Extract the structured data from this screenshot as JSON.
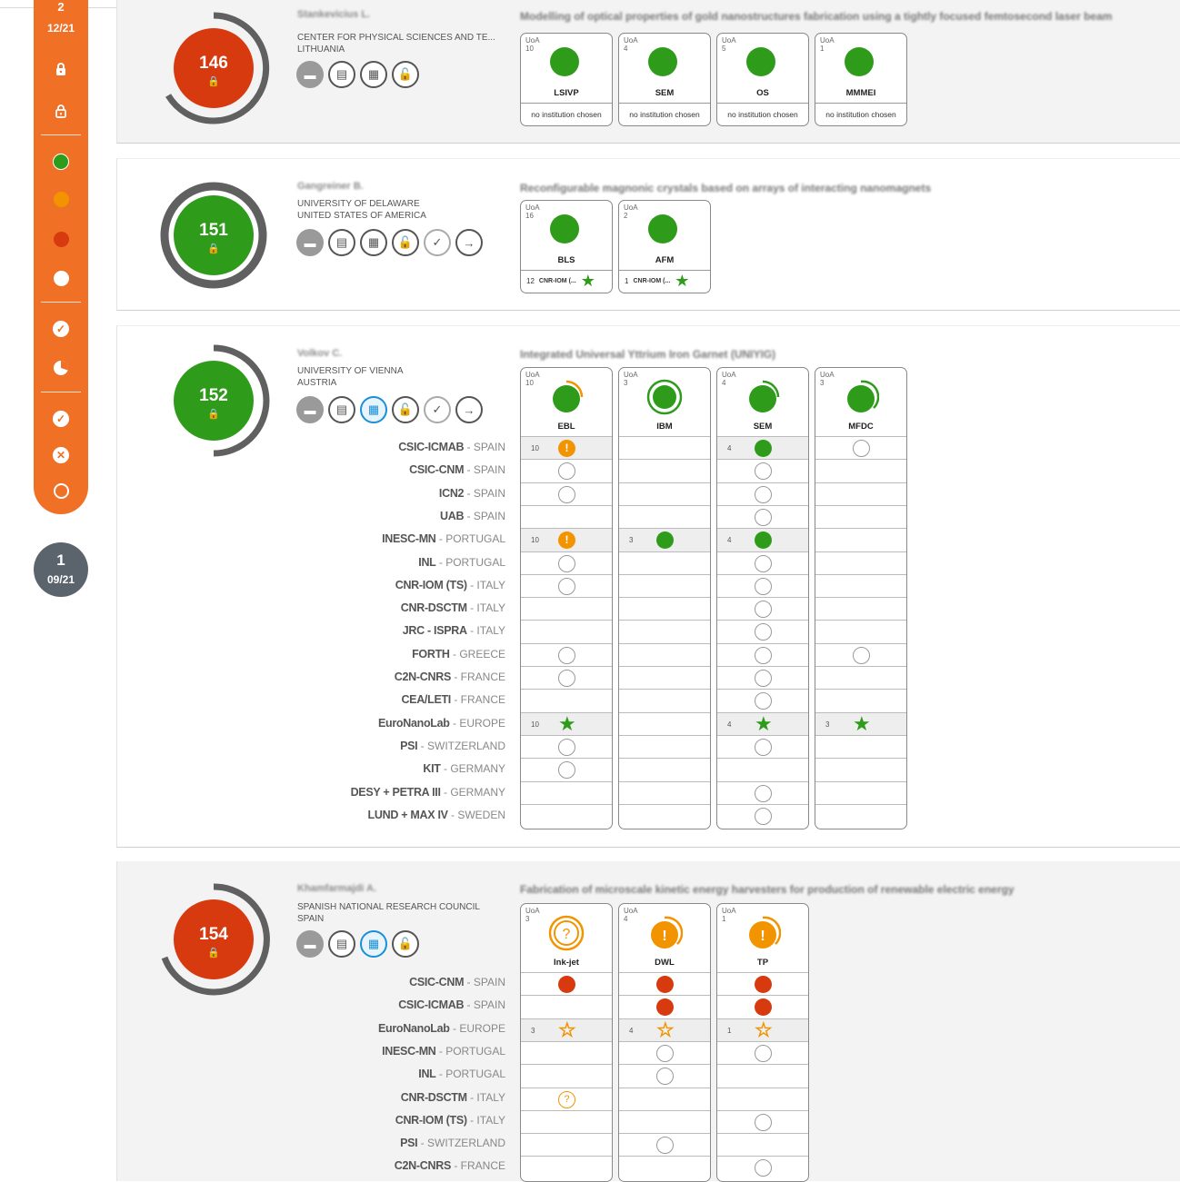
{
  "sidebar": {
    "top_number": "2",
    "top_date": "12/21",
    "filter_icons": [
      "lock-solid-icon",
      "lock-open-icon",
      "green-dot-icon",
      "orange-dot-icon",
      "red-dot-icon",
      "white-dot-icon",
      "check-circle-icon",
      "pie-icon",
      "check-circle-icon",
      "x-circle-icon",
      "ring-icon"
    ]
  },
  "month_badge": {
    "number": "1",
    "date": "09/21"
  },
  "colors": {
    "accent_orange": "#f07026",
    "green": "#2e9c1a",
    "red": "#d63a0e",
    "orange": "#f29400",
    "grey_badge": "#5b646d"
  },
  "proposals": [
    {
      "score": "146",
      "pi": "Stankevicius L.",
      "title": "Modelling of optical properties of gold nanostructures fabrication using a tightly focused femtosecond laser beam",
      "institution": "CENTER FOR PHYSICAL SCIENCES AND TE...",
      "country": "LITHUANIA",
      "techniques": [
        {
          "name": "LSIVP",
          "uoa": "10",
          "foot": "no institution chosen"
        },
        {
          "name": "SEM",
          "uoa": "4",
          "foot": "no institution chosen"
        },
        {
          "name": "OS",
          "uoa": "5",
          "foot": "no institution chosen"
        },
        {
          "name": "MMMEI",
          "uoa": "1",
          "foot": "no institution chosen"
        }
      ]
    },
    {
      "score": "151",
      "pi": "Gangreiner B.",
      "title": "Reconfigurable magnonic crystals based on arrays of interacting nanomagnets",
      "institution": "UNIVERSITY OF DELAWARE",
      "country": "UNITED STATES OF AMERICA",
      "techniques": [
        {
          "name": "BLS",
          "uoa": "16",
          "foot_count": "12",
          "foot_inst": "CNR-IOM (..."
        },
        {
          "name": "AFM",
          "uoa": "2",
          "foot_count": "1",
          "foot_inst": "CNR-IOM (..."
        }
      ]
    },
    {
      "score": "152",
      "pi": "Volkov C.",
      "title": "Integrated Universal Yttrium Iron Garnet (UNIYIG)",
      "institution": "UNIVERSITY OF VIENNA",
      "country": "AUSTRIA",
      "techniques": [
        {
          "name": "EBL",
          "uoa": "10"
        },
        {
          "name": "IBM",
          "uoa": "3"
        },
        {
          "name": "SEM",
          "uoa": "4"
        },
        {
          "name": "MFDC",
          "uoa": "3"
        }
      ],
      "rows": [
        {
          "inst": "CSIC-ICMAB",
          "country": "SPAIN"
        },
        {
          "inst": "CSIC-CNM",
          "country": "SPAIN"
        },
        {
          "inst": "ICN2",
          "country": "SPAIN"
        },
        {
          "inst": "UAB",
          "country": "SPAIN"
        },
        {
          "inst": "INESC-MN",
          "country": "PORTUGAL"
        },
        {
          "inst": "INL",
          "country": "PORTUGAL"
        },
        {
          "inst": "CNR-IOM (TS)",
          "country": "ITALY"
        },
        {
          "inst": "CNR-DSCTM",
          "country": "ITALY"
        },
        {
          "inst": "JRC - ISPRA",
          "country": "ITALY"
        },
        {
          "inst": "FORTH",
          "country": "GREECE"
        },
        {
          "inst": "C2N-CNRS",
          "country": "FRANCE"
        },
        {
          "inst": "CEA/LETI",
          "country": "FRANCE"
        },
        {
          "inst": "EuroNanoLab",
          "country": "EUROPE"
        },
        {
          "inst": "PSI",
          "country": "SWITZERLAND"
        },
        {
          "inst": "KIT",
          "country": "GERMANY"
        },
        {
          "inst": "DESY + PETRA III",
          "country": "GERMANY"
        },
        {
          "inst": "LUND + MAX IV",
          "country": "SWEDEN"
        }
      ],
      "cells": {
        "EBL": {
          "0": "orange-warn:10",
          "1": "empty",
          "2": "empty",
          "4": "orange-warn:10",
          "5": "empty",
          "6": "empty",
          "9": "empty",
          "10": "empty",
          "12": "star:10",
          "13": "empty",
          "14": "empty"
        },
        "IBM": {
          "4": "green:3"
        },
        "SEM": {
          "0": "green:4",
          "1": "empty",
          "2": "empty",
          "3": "empty",
          "4": "green:4",
          "5": "empty",
          "6": "empty",
          "7": "empty",
          "8": "empty",
          "9": "empty",
          "10": "empty",
          "11": "empty",
          "12": "star:4",
          "13": "empty",
          "15": "empty",
          "16": "empty"
        },
        "MFDC": {
          "0": "empty",
          "9": "empty",
          "12": "star:3"
        }
      }
    },
    {
      "score": "154",
      "pi": "Khamfarmajdi A.",
      "title": "Fabrication of microscale kinetic energy harvesters for production of renewable electric energy",
      "institution": "SPANISH NATIONAL RESEARCH COUNCIL",
      "country": "SPAIN",
      "techniques": [
        {
          "name": "Ink-jet",
          "uoa": "3"
        },
        {
          "name": "DWL",
          "uoa": "4"
        },
        {
          "name": "TP",
          "uoa": "1"
        }
      ],
      "rows": [
        {
          "inst": "CSIC-CNM",
          "country": "SPAIN"
        },
        {
          "inst": "CSIC-ICMAB",
          "country": "SPAIN"
        },
        {
          "inst": "EuroNanoLab",
          "country": "EUROPE"
        },
        {
          "inst": "INESC-MN",
          "country": "PORTUGAL"
        },
        {
          "inst": "INL",
          "country": "PORTUGAL"
        },
        {
          "inst": "CNR-DSCTM",
          "country": "ITALY"
        },
        {
          "inst": "CNR-IOM (TS)",
          "country": "ITALY"
        },
        {
          "inst": "PSI",
          "country": "SWITZERLAND"
        },
        {
          "inst": "C2N-CNRS",
          "country": "FRANCE"
        }
      ],
      "cells": {
        "Ink-jet": {
          "0": "red",
          "2": "ostar:3",
          "5": "qmark"
        },
        "DWL": {
          "0": "red",
          "1": "red",
          "2": "ostar:4",
          "3": "empty",
          "4": "empty",
          "7": "empty"
        },
        "TP": {
          "0": "red",
          "1": "red",
          "2": "ostar:1",
          "3": "empty",
          "6": "empty",
          "8": "empty"
        }
      }
    }
  ]
}
